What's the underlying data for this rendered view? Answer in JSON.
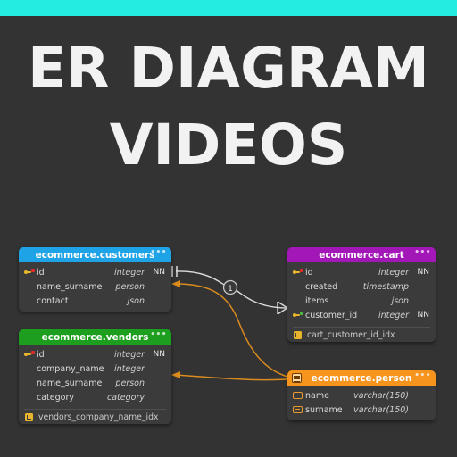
{
  "page": {
    "background_color": "#333333",
    "top_bar_color": "#25ECE0"
  },
  "title": {
    "line1": "ER DIAGRAM",
    "line2": "VIDEOS",
    "color": "#F2F2F2"
  },
  "tables": [
    {
      "id": "customers",
      "name": "ecommerce.customers",
      "header_color": "#1EA3E6",
      "menu_glyph": "•••",
      "columns": [
        {
          "icon": "primary-key-icon",
          "name": "id",
          "type": "integer",
          "nn": "NN"
        },
        {
          "icon": "none",
          "name": "name_surname",
          "type": "person",
          "nn": ""
        },
        {
          "icon": "none",
          "name": "contact",
          "type": "json",
          "nn": ""
        }
      ],
      "indexes": []
    },
    {
      "id": "cart",
      "name": "ecommerce.cart",
      "header_color": "#A317B8",
      "menu_glyph": "•••",
      "columns": [
        {
          "icon": "primary-key-icon",
          "name": "id",
          "type": "integer",
          "nn": "NN"
        },
        {
          "icon": "none",
          "name": "created",
          "type": "timestamp",
          "nn": ""
        },
        {
          "icon": "none",
          "name": "items",
          "type": "json",
          "nn": ""
        },
        {
          "icon": "foreign-key-icon",
          "name": "customer_id",
          "type": "integer",
          "nn": "NN"
        }
      ],
      "indexes": [
        {
          "icon": "index-icon",
          "name": "cart_customer_id_idx"
        }
      ]
    },
    {
      "id": "vendors",
      "name": "ecommerce.vendors",
      "header_color": "#1E9E1E",
      "menu_glyph": "•••",
      "columns": [
        {
          "icon": "primary-key-icon",
          "name": "id",
          "type": "integer",
          "nn": "NN"
        },
        {
          "icon": "none",
          "name": "company_name",
          "type": "integer",
          "nn": ""
        },
        {
          "icon": "none",
          "name": "name_surname",
          "type": "person",
          "nn": ""
        },
        {
          "icon": "none",
          "name": "category",
          "type": "category",
          "nn": ""
        }
      ],
      "indexes": [
        {
          "icon": "index-icon",
          "name": "vendors_company_name_idx"
        }
      ]
    },
    {
      "id": "person",
      "name": "ecommerce.person",
      "header_color": "#F7941E",
      "menu_glyph": "•••",
      "header_icon": "type-table-icon",
      "columns": [
        {
          "icon": "udt-attribute-icon",
          "name": "name",
          "type": "varchar(150)",
          "nn": ""
        },
        {
          "icon": "udt-attribute-icon",
          "name": "surname",
          "type": "varchar(150)",
          "nn": ""
        }
      ],
      "indexes": []
    }
  ],
  "relationships": [
    {
      "id": "customers-cart",
      "name": "identifying-relationship",
      "from": "ecommerce.customers.id",
      "to": "ecommerce.cart.customer_id",
      "color": "#DCDCDC",
      "cardinality_badge": "1",
      "source_marker": "one-bar",
      "target_marker": "crows-foot"
    },
    {
      "id": "person-customers",
      "name": "type-usage-link",
      "from": "ecommerce.person",
      "to": "ecommerce.customers.name_surname",
      "color": "#D98B1E",
      "cardinality_badge": "",
      "source_marker": "none",
      "target_marker": "arrow"
    },
    {
      "id": "person-vendors",
      "name": "type-usage-link",
      "from": "ecommerce.person",
      "to": "ecommerce.vendors.name_surname",
      "color": "#D98B1E",
      "cardinality_badge": "",
      "source_marker": "none",
      "target_marker": "arrow"
    }
  ]
}
